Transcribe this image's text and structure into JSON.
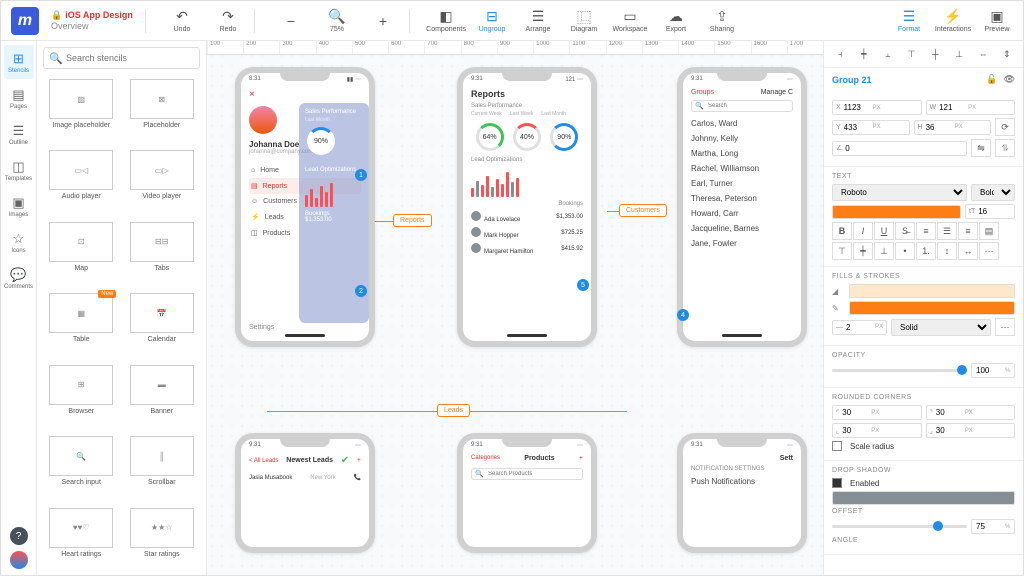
{
  "header": {
    "app_logo": "m",
    "doc_title": "iOS App Design",
    "doc_sub": "Overview",
    "tools": {
      "undo": "Undo",
      "redo": "Redo",
      "zoom": "75%",
      "components": "Components",
      "ungroup": "Ungroup",
      "arrange": "Arrange",
      "diagram": "Diagram",
      "workspace": "Workspace",
      "export": "Export",
      "sharing": "Sharing"
    },
    "right": {
      "format": "Format",
      "interactions": "Interactions",
      "preview": "Preview"
    }
  },
  "rail": {
    "stencils": "Stencils",
    "pages": "Pages",
    "outline": "Outline",
    "templates": "Templates",
    "images": "Images",
    "icons": "Icons",
    "comments": "Comments"
  },
  "stencils": {
    "search_ph": "Search stencils",
    "items": [
      {
        "label": "Image placeholder"
      },
      {
        "label": "Placeholder"
      },
      {
        "label": "Audio player"
      },
      {
        "label": "Video player"
      },
      {
        "label": "Map"
      },
      {
        "label": "Tabs"
      },
      {
        "label": "Table",
        "new": true
      },
      {
        "label": "Calendar"
      },
      {
        "label": "Browser"
      },
      {
        "label": "Banner"
      },
      {
        "label": "Search input"
      },
      {
        "label": "Scrollbar"
      },
      {
        "label": "Heart ratings"
      },
      {
        "label": "Star ratings"
      }
    ]
  },
  "ruler": [
    "100",
    "200",
    "300",
    "400",
    "500",
    "600",
    "700",
    "800",
    "900",
    "1000",
    "1100",
    "1200",
    "1300",
    "1400",
    "1500",
    "1600",
    "1700"
  ],
  "canvas": {
    "phone1": {
      "time": "8:31",
      "name": "Johanna Doe",
      "email": "johanna@company.com",
      "perf_title": "Sales Performance",
      "perf_sub": "Last Month",
      "perf_pct": "90%",
      "lead_title": "Lead Optimizations",
      "book_title": "Bookings",
      "book_val": "$1,353.00",
      "menu": [
        "Home",
        "Reports",
        "Customers",
        "Leads",
        "Products"
      ],
      "settings": "Settings"
    },
    "phone2": {
      "time": "9:31",
      "title": "Reports",
      "signal": "121",
      "perf_title": "Sales Performance",
      "tabs": [
        "Current Week",
        "Last Week",
        "Last Month"
      ],
      "d1": "64%",
      "d2": "40%",
      "d3": "90%",
      "lead_title": "Lead Optimizations",
      "book_title": "Bookings",
      "bookings": [
        {
          "name": "Ada Lovelace",
          "amt": "$1,353.00"
        },
        {
          "name": "Mark Hopper",
          "amt": "$725.25"
        },
        {
          "name": "Margaret Hamilton",
          "amt": "$415.92"
        }
      ]
    },
    "phone3": {
      "time": "9:31",
      "customers": [
        "Carlos, Ward",
        "Johnny, Kelly",
        "Martha, Long",
        "Rachel, Williamson",
        "Earl, Turner",
        "Theresa, Peterson",
        "Howard, Carr",
        "Jacqueline, Barnes",
        "Jane, Fowler"
      ],
      "search_ph": "Search",
      "groups": "Groups",
      "manage": "Manage C"
    },
    "phone4": {
      "time": "9:31",
      "back": "< All Leads",
      "title": "Newest Leads",
      "row1": "Jasia Musabook",
      "loc": "New York"
    },
    "phone5": {
      "time": "9:31",
      "cat": "Categories",
      "title": "Products",
      "search_ph": "Search Products"
    },
    "phone6": {
      "time": "9:31",
      "title": "Sett",
      "sec": "NOTIFICATION SETTINGS",
      "row": "Push Notifications"
    },
    "labels": {
      "reports": "Reports",
      "customers": "Customers",
      "leads": "Leads"
    }
  },
  "props": {
    "group_name": "Group 21",
    "x": "1123",
    "y": "433",
    "w": "121",
    "h": "36",
    "r": "0",
    "text_section": "TEXT",
    "font": "Roboto",
    "weight": "Bold",
    "size": "16",
    "fills_section": "FILLS & STROKES",
    "stroke_w": "2",
    "stroke_style": "Solid",
    "opacity_section": "OPACITY",
    "opacity": "100",
    "corners_section": "ROUNDED CORNERS",
    "corner": "30",
    "scale_radius": "Scale radius",
    "shadow_section": "DROP SHADOW",
    "enabled": "Enabled",
    "offset_lbl": "OFFSET",
    "offset": "75",
    "angle_lbl": "ANGLE",
    "colors": {
      "accent": "#fd7e14",
      "accent2": "#fa5252",
      "fill": "#ffe8cc"
    }
  }
}
